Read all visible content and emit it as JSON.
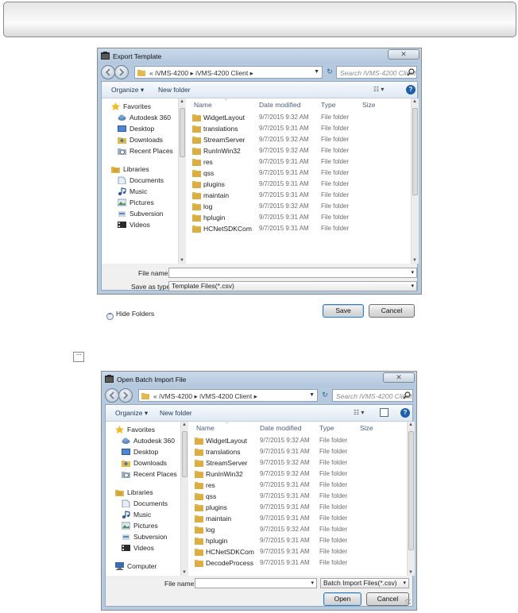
{
  "colors": {
    "folder": "#e3b84f",
    "folder_dark": "#c89a2e",
    "title_bar": "#b5c9df",
    "link": "#1e395b",
    "help_blue": "#1d5fab"
  },
  "icons": {
    "app": "dialog-app-icon",
    "folder": "folder-icon",
    "favorites": "star-icon",
    "libraries": "library-icon",
    "computer": "computer-icon",
    "search": "search-icon",
    "refresh": "refresh-icon",
    "help": "help-icon"
  },
  "ellipsis_button": {
    "label": "···"
  },
  "export_dialog": {
    "title": "Export Template",
    "close": "✕",
    "address": {
      "prefix": "«",
      "crumbs": [
        "iVMS-4200",
        "iVMS-4200 Client"
      ],
      "sep": "▸",
      "text": "« iVMS-4200 ▸ iVMS-4200 Client ▸"
    },
    "search_placeholder": "Search iVMS-4200 Client",
    "toolbar": {
      "organize": "Organize ▾",
      "new_folder": "New folder",
      "views": "☷ ▾",
      "help": "?"
    },
    "nav": [
      {
        "label": "Favorites",
        "icon": "star-icon"
      },
      {
        "label": "Autodesk 360",
        "icon": "cloud-icon"
      },
      {
        "label": "Desktop",
        "icon": "desktop-icon"
      },
      {
        "label": "Downloads",
        "icon": "downloads-icon"
      },
      {
        "label": "Recent Places",
        "icon": "recent-places-icon"
      },
      {
        "label": "Libraries",
        "icon": "library-icon"
      },
      {
        "label": "Documents",
        "icon": "documents-icon"
      },
      {
        "label": "Music",
        "icon": "music-icon"
      },
      {
        "label": "Pictures",
        "icon": "pictures-icon"
      },
      {
        "label": "Subversion",
        "icon": "subversion-icon"
      },
      {
        "label": "Videos",
        "icon": "videos-icon"
      }
    ],
    "columns": {
      "name": "Name",
      "date": "Date modified",
      "type": "Type",
      "size": "Size"
    },
    "files": [
      {
        "name": "WidgetLayout",
        "date": "9/7/2015 9:32 AM",
        "type": "File folder"
      },
      {
        "name": "translations",
        "date": "9/7/2015 9:31 AM",
        "type": "File folder"
      },
      {
        "name": "StreamServer",
        "date": "9/7/2015 9:32 AM",
        "type": "File folder"
      },
      {
        "name": "RunInWin32",
        "date": "9/7/2015 9:32 AM",
        "type": "File folder"
      },
      {
        "name": "res",
        "date": "9/7/2015 9:31 AM",
        "type": "File folder"
      },
      {
        "name": "qss",
        "date": "9/7/2015 9:31 AM",
        "type": "File folder"
      },
      {
        "name": "plugins",
        "date": "9/7/2015 9:31 AM",
        "type": "File folder"
      },
      {
        "name": "maintain",
        "date": "9/7/2015 9:31 AM",
        "type": "File folder"
      },
      {
        "name": "log",
        "date": "9/7/2015 9:32 AM",
        "type": "File folder"
      },
      {
        "name": "hplugin",
        "date": "9/7/2015 9:31 AM",
        "type": "File folder"
      },
      {
        "name": "HCNetSDKCom",
        "date": "9/7/2015 9:31 AM",
        "type": "File folder"
      }
    ],
    "file_name_label": "File name:",
    "file_name_value": "",
    "save_type_label": "Save as type:",
    "save_type_value": "Template Files(*.csv)",
    "hide_folders": "Hide Folders",
    "save_button": "Save",
    "cancel_button": "Cancel"
  },
  "import_dialog": {
    "title": "Open Batch Import File",
    "close": "✕",
    "address": {
      "prefix": "«",
      "crumbs": [
        "iVMS-4200",
        "iVMS-4200 Client"
      ],
      "sep": "▸",
      "text": "« iVMS-4200 ▸ iVMS-4200 Client ▸"
    },
    "search_placeholder": "Search iVMS-4200 Client",
    "toolbar": {
      "organize": "Organize ▾",
      "new_folder": "New folder",
      "views": "☷ ▾",
      "help": "?"
    },
    "nav": [
      {
        "label": "Favorites",
        "icon": "star-icon"
      },
      {
        "label": "Autodesk 360",
        "icon": "cloud-icon"
      },
      {
        "label": "Desktop",
        "icon": "desktop-icon"
      },
      {
        "label": "Downloads",
        "icon": "downloads-icon"
      },
      {
        "label": "Recent Places",
        "icon": "recent-places-icon"
      },
      {
        "label": "Libraries",
        "icon": "library-icon"
      },
      {
        "label": "Documents",
        "icon": "documents-icon"
      },
      {
        "label": "Music",
        "icon": "music-icon"
      },
      {
        "label": "Pictures",
        "icon": "pictures-icon"
      },
      {
        "label": "Subversion",
        "icon": "subversion-icon"
      },
      {
        "label": "Videos",
        "icon": "videos-icon"
      },
      {
        "label": "Computer",
        "icon": "computer-icon"
      }
    ],
    "columns": {
      "name": "Name",
      "date": "Date modified",
      "type": "Type",
      "size": "Size"
    },
    "files": [
      {
        "name": "WidgetLayout",
        "date": "9/7/2015 9:32 AM",
        "type": "File folder"
      },
      {
        "name": "translations",
        "date": "9/7/2015 9:31 AM",
        "type": "File folder"
      },
      {
        "name": "StreamServer",
        "date": "9/7/2015 9:32 AM",
        "type": "File folder"
      },
      {
        "name": "RunInWin32",
        "date": "9/7/2015 9:32 AM",
        "type": "File folder"
      },
      {
        "name": "res",
        "date": "9/7/2015 9:31 AM",
        "type": "File folder"
      },
      {
        "name": "qss",
        "date": "9/7/2015 9:31 AM",
        "type": "File folder"
      },
      {
        "name": "plugins",
        "date": "9/7/2015 9:31 AM",
        "type": "File folder"
      },
      {
        "name": "maintain",
        "date": "9/7/2015 9:31 AM",
        "type": "File folder"
      },
      {
        "name": "log",
        "date": "9/7/2015 9:32 AM",
        "type": "File folder"
      },
      {
        "name": "hplugin",
        "date": "9/7/2015 9:31 AM",
        "type": "File folder"
      },
      {
        "name": "HCNetSDKCom",
        "date": "9/7/2015 9:31 AM",
        "type": "File folder"
      },
      {
        "name": "DecodeProcess",
        "date": "9/7/2015 9:31 AM",
        "type": "File folder"
      }
    ],
    "file_name_label": "File name:",
    "file_name_value": "",
    "file_type_value": "Batch Import Files(*.csv)",
    "open_button": "Open",
    "cancel_button": "Cancel"
  }
}
